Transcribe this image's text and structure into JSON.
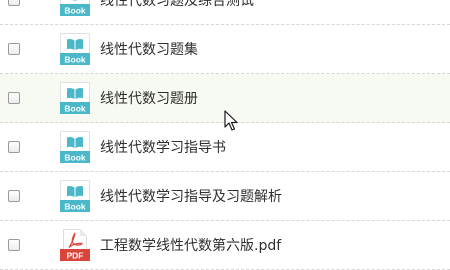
{
  "files": [
    {
      "name": "线性代数习题及综合测试",
      "type": "book",
      "type_label": "Book"
    },
    {
      "name": "线性代数习题集",
      "type": "book",
      "type_label": "Book"
    },
    {
      "name": "线性代数习题册",
      "type": "book",
      "type_label": "Book"
    },
    {
      "name": "线性代数学习指导书",
      "type": "book",
      "type_label": "Book"
    },
    {
      "name": "线性代数学习指导及习题解析",
      "type": "book",
      "type_label": "Book"
    },
    {
      "name": "工程数学线性代数第六版.pdf",
      "type": "pdf",
      "type_label": "PDF"
    }
  ],
  "hovered_index": 2,
  "colors": {
    "book_icon": "#4bb8c9",
    "pdf_icon": "#d9453b",
    "hover_row": "#f7faf2",
    "divider": "#d6d6d6"
  },
  "icons": {
    "book": "book-file-icon",
    "pdf": "pdf-file-icon",
    "pointer": "mouse-cursor-icon"
  }
}
